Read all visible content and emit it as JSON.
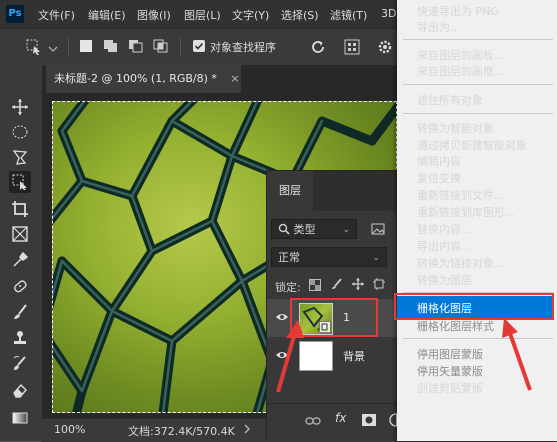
{
  "app": {
    "logo_text": "Ps"
  },
  "menubar": {
    "items": [
      "文件(F)",
      "编辑(E)",
      "图像(I)",
      "图层(L)",
      "文字(Y)",
      "选择(S)",
      "滤镜(T)",
      "3D"
    ]
  },
  "options": {
    "select_subject_label": "对象查找程序"
  },
  "document": {
    "tab_title": "未标题-2 @ 100% (1, RGB/8) *",
    "close": "×"
  },
  "status": {
    "zoom": "100%",
    "doc_info": "文档:372.4K/570.4K"
  },
  "layers_panel": {
    "title": "图层",
    "filter_label": "类型",
    "blend_mode": "正常",
    "lock_label": "锁定:",
    "layers": [
      {
        "name": "1"
      },
      {
        "name": "背景"
      }
    ],
    "footer_fx": "fx"
  },
  "context_menu": {
    "groups": [
      [
        {
          "label": "快速导出为 PNG",
          "disabled": false
        },
        {
          "label": "导出为...",
          "disabled": false
        }
      ],
      [
        {
          "label": "来自图层的画板...",
          "disabled": false
        },
        {
          "label": "来自图层的画框...",
          "disabled": false
        }
      ],
      [
        {
          "label": "遮住所有对象",
          "disabled": false
        }
      ],
      [
        {
          "label": "转换为智能对象",
          "disabled": false
        },
        {
          "label": "通过拷贝新建智能对象",
          "disabled": false
        },
        {
          "label": "编辑内容",
          "disabled": false
        },
        {
          "label": "复位变换",
          "disabled": false
        },
        {
          "label": "重新链接到文件...",
          "disabled": false
        },
        {
          "label": "重新链接到库图形...",
          "disabled": false
        },
        {
          "label": "替换内容...",
          "disabled": false
        },
        {
          "label": "导出内容...",
          "disabled": false
        },
        {
          "label": "转换为链接对象...",
          "disabled": false
        },
        {
          "label": "转换为图层",
          "disabled": false
        }
      ],
      [
        {
          "label": "栅格化图层",
          "disabled": false,
          "highlighted": true
        },
        {
          "label": "栅格化图层样式",
          "disabled": true
        }
      ],
      [
        {
          "label": "停用图层蒙版",
          "disabled": true
        },
        {
          "label": "停用矢量蒙版",
          "disabled": true
        },
        {
          "label": "创建剪贴蒙版",
          "disabled": false
        }
      ]
    ]
  },
  "colors": {
    "highlight": "#0078d7",
    "annotation": "#e53935",
    "ps_blue": "#31a8ff"
  }
}
